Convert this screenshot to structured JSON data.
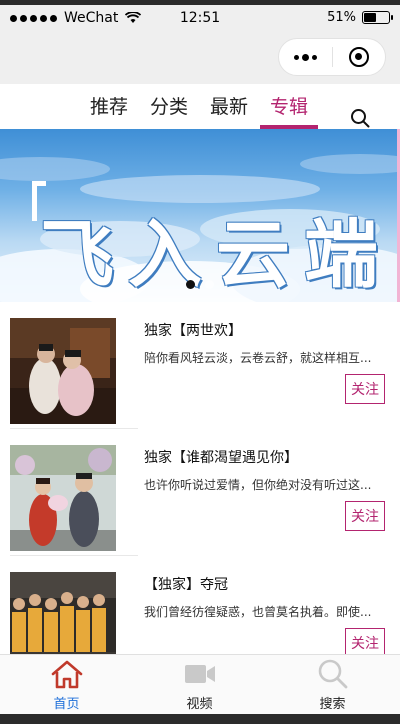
{
  "status_bar": {
    "carrier": "WeChat",
    "time": "12:51",
    "battery_text": "51%",
    "battery_level": 0.51
  },
  "tabs": [
    {
      "label": "推荐",
      "active": false
    },
    {
      "label": "分类",
      "active": false
    },
    {
      "label": "最新",
      "active": false
    },
    {
      "label": "专辑",
      "active": true
    }
  ],
  "banner": {
    "title": "飞入云端",
    "dots": 2,
    "active_dot": 0
  },
  "items": [
    {
      "title": "独家【两世欢】",
      "desc": "陪你看风轻云淡，云卷云舒，就这样相互...",
      "follow_label": "关注"
    },
    {
      "title": "独家【谁都渴望遇见你】",
      "desc": "也许你听说过爱情，但你绝对没有听过这...",
      "follow_label": "关注"
    },
    {
      "title": "【独家】夺冠",
      "desc": "我们曾经彷徨疑惑，也曾莫名执着。即使...",
      "follow_label": "关注"
    }
  ],
  "bottom_nav": [
    {
      "label": "首页",
      "icon": "home-icon",
      "active": true
    },
    {
      "label": "视频",
      "icon": "video-icon",
      "active": false
    },
    {
      "label": "搜索",
      "icon": "search-icon",
      "active": false
    }
  ],
  "colors": {
    "accent": "#b3246f",
    "active_nav": "#1e6fd9",
    "home_icon": "#c0392b"
  }
}
